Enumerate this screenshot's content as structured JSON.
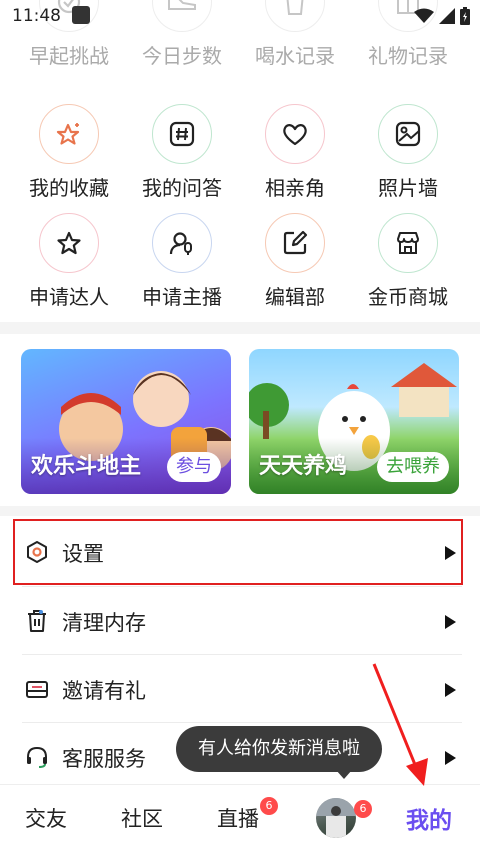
{
  "status_bar": {
    "time": "11:48"
  },
  "grid": [
    [
      {
        "label": "早起挑战",
        "icon": "clock-check-icon",
        "color": "#bfbfbf"
      },
      {
        "label": "今日步数",
        "icon": "sneaker-icon",
        "color": "#bfbfbf"
      },
      {
        "label": "喝水记录",
        "icon": "cup-icon",
        "color": "#bfbfbf"
      },
      {
        "label": "礼物记录",
        "icon": "gift-icon",
        "color": "#bfbfbf"
      }
    ],
    [
      {
        "label": "我的收藏",
        "icon": "star-sparkle-icon",
        "color": "#e8744c"
      },
      {
        "label": "我的问答",
        "icon": "hashtag-icon",
        "color": "#2f9f5f"
      },
      {
        "label": "相亲角",
        "icon": "heart-icon",
        "color": "#e05566"
      },
      {
        "label": "照片墙",
        "icon": "photo-icon",
        "color": "#2f9f5f"
      }
    ],
    [
      {
        "label": "申请达人",
        "icon": "star-outline-icon",
        "color": "#e05566"
      },
      {
        "label": "申请主播",
        "icon": "user-mic-icon",
        "color": "#4a6fd1"
      },
      {
        "label": "编辑部",
        "icon": "edit-icon",
        "color": "#e8744c"
      },
      {
        "label": "金币商城",
        "icon": "store-icon",
        "color": "#2f9f5f"
      }
    ]
  ],
  "banners": [
    {
      "title": "欢乐斗地主",
      "button": "参与"
    },
    {
      "title": "天天养鸡",
      "button": "去喂养"
    }
  ],
  "list": [
    {
      "label": "设置",
      "icon": "settings-hex-icon"
    },
    {
      "label": "清理内存",
      "icon": "trash-icon"
    },
    {
      "label": "邀请有礼",
      "icon": "mail-icon"
    },
    {
      "label": "客服服务",
      "icon": "headset-icon"
    }
  ],
  "toast": "有人给你发新消息啦",
  "nav": {
    "items": [
      "交友",
      "社区",
      "直播",
      "我的"
    ],
    "live_badge": "6",
    "avatar_badge": "6",
    "active_color": "#6a4ef0"
  }
}
